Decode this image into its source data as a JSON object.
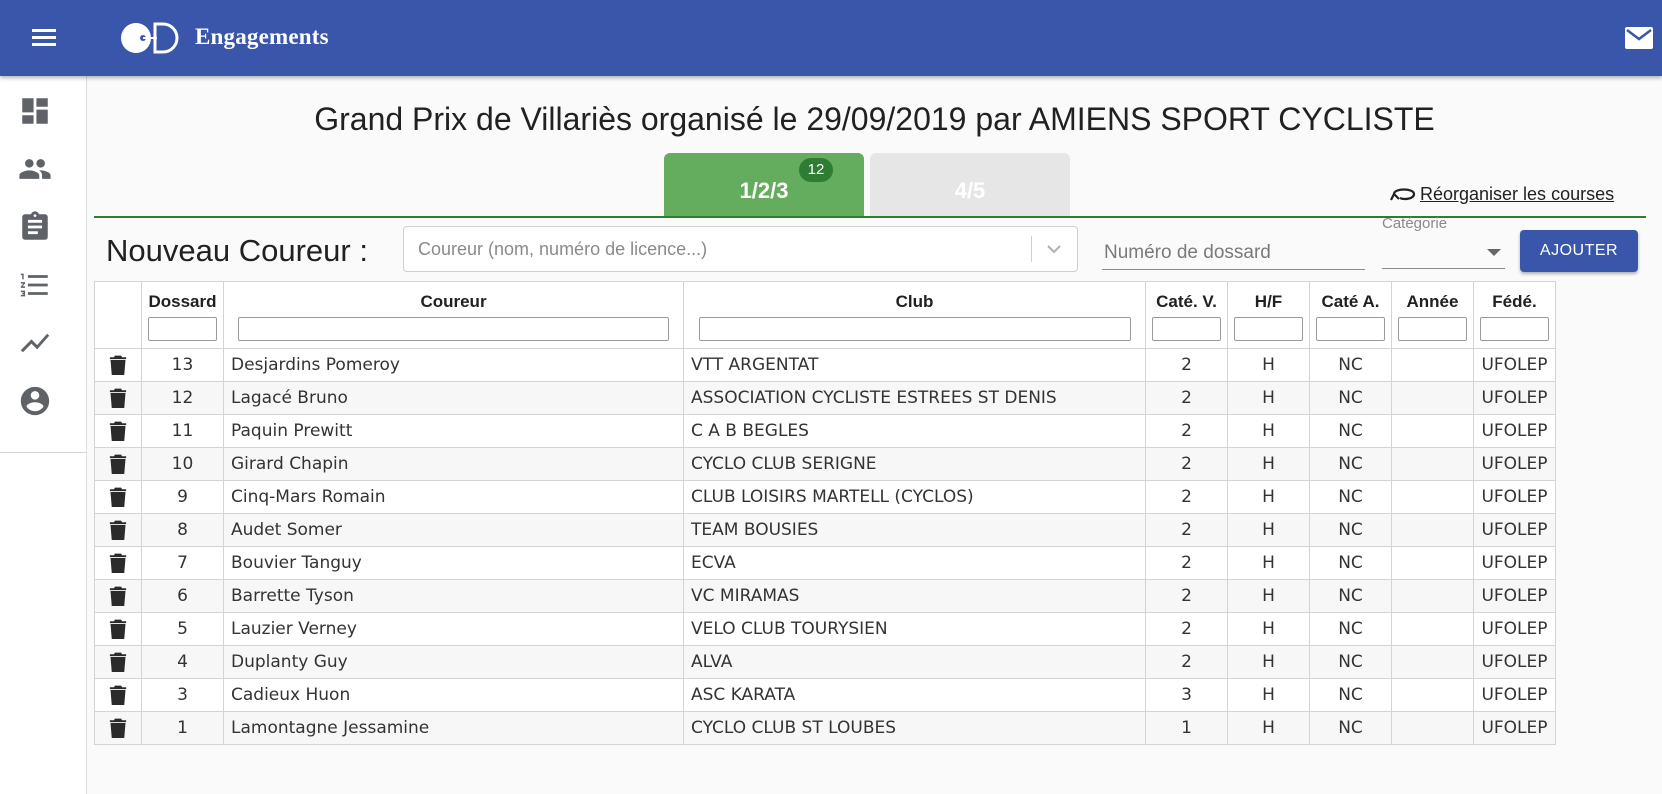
{
  "appbar": {
    "title": "Engagements",
    "menu_icon": "menu-icon",
    "mail_icon": "mail-icon"
  },
  "sidebar": {
    "items": [
      {
        "icon": "dashboard-icon"
      },
      {
        "icon": "people-icon"
      },
      {
        "icon": "clipboard-icon"
      },
      {
        "icon": "list-icon"
      },
      {
        "icon": "trending-icon"
      },
      {
        "icon": "account-icon"
      }
    ]
  },
  "page": {
    "title": "Grand Prix de Villariès organisé le 29/09/2019 par AMIENS SPORT CYCLISTE"
  },
  "tabs": [
    {
      "label": "1/2/3",
      "badge": "12",
      "active": true
    },
    {
      "label": "4/5",
      "active": false
    }
  ],
  "reorganize": {
    "label": "Réorganiser les courses",
    "icon": "reorder-icon"
  },
  "new_runner": {
    "label": "Nouveau Coureur :",
    "runner_placeholder": "Coureur (nom, numéro de licence...)",
    "dossard_placeholder": "Numéro de dossard",
    "category_label": "Catégorie",
    "category_value": "",
    "add_label": "AJOUTER"
  },
  "colors": {
    "primary": "#3956ab",
    "tab_active": "#64ad5e",
    "badge": "#2e7d32",
    "tab_inactive": "#e6e6e6"
  },
  "table": {
    "headers": [
      "",
      "Dossard",
      "Coureur",
      "Club",
      "Caté. V.",
      "H/F",
      "Caté A.",
      "Année",
      "Fédé."
    ],
    "rows": [
      [
        "13",
        "Desjardins Pomeroy",
        "VTT ARGENTAT",
        "2",
        "H",
        "NC",
        "",
        "UFOLEP"
      ],
      [
        "12",
        "Lagacé Bruno",
        "ASSOCIATION CYCLISTE ESTREES ST DENIS",
        "2",
        "H",
        "NC",
        "",
        "UFOLEP"
      ],
      [
        "11",
        "Paquin Prewitt",
        "C A B BEGLES",
        "2",
        "H",
        "NC",
        "",
        "UFOLEP"
      ],
      [
        "10",
        "Girard Chapin",
        "CYCLO CLUB SERIGNE",
        "2",
        "H",
        "NC",
        "",
        "UFOLEP"
      ],
      [
        "9",
        "Cinq-Mars Romain",
        "CLUB LOISIRS MARTELL (CYCLOS)",
        "2",
        "H",
        "NC",
        "",
        "UFOLEP"
      ],
      [
        "8",
        "Audet Somer",
        "TEAM BOUSIES",
        "2",
        "H",
        "NC",
        "",
        "UFOLEP"
      ],
      [
        "7",
        "Bouvier Tanguy",
        "ECVA",
        "2",
        "H",
        "NC",
        "",
        "UFOLEP"
      ],
      [
        "6",
        "Barrette Tyson",
        "VC MIRAMAS",
        "2",
        "H",
        "NC",
        "",
        "UFOLEP"
      ],
      [
        "5",
        "Lauzier Verney",
        "VELO CLUB TOURYSIEN",
        "2",
        "H",
        "NC",
        "",
        "UFOLEP"
      ],
      [
        "4",
        "Duplanty Guy",
        "ALVA",
        "2",
        "H",
        "NC",
        "",
        "UFOLEP"
      ],
      [
        "3",
        "Cadieux Huon",
        "ASC KARATA",
        "3",
        "H",
        "NC",
        "",
        "UFOLEP"
      ],
      [
        "1",
        "Lamontagne Jessamine",
        "CYCLO CLUB ST LOUBES",
        "1",
        "H",
        "NC",
        "",
        "UFOLEP"
      ]
    ]
  }
}
